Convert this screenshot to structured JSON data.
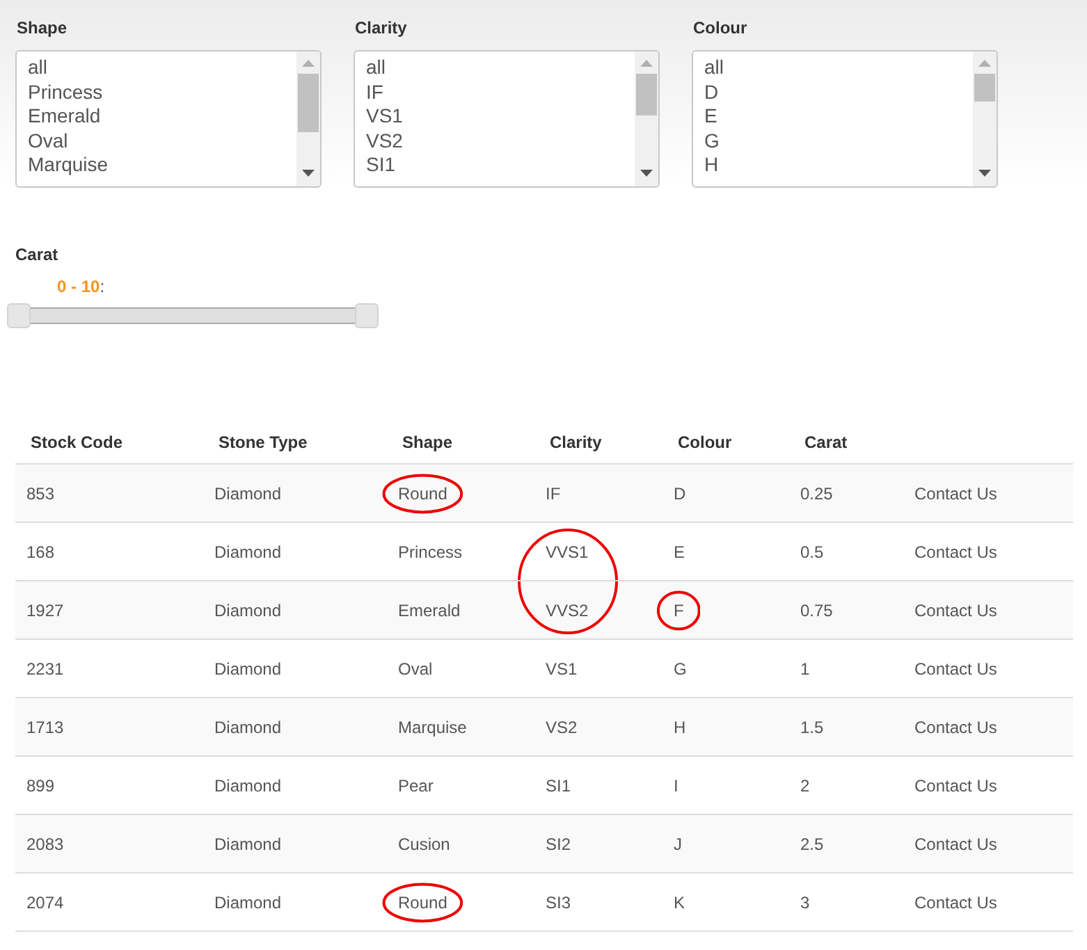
{
  "filters": [
    {
      "label": "Shape",
      "options": [
        "all",
        "Princess",
        "Emerald",
        "Oval",
        "Marquise"
      ]
    },
    {
      "label": "Clarity",
      "options": [
        "all",
        "IF",
        "VS1",
        "VS2",
        "SI1"
      ]
    },
    {
      "label": "Colour",
      "options": [
        "all",
        "D",
        "E",
        "G",
        "H"
      ]
    }
  ],
  "carat": {
    "label": "Carat",
    "value": "0 - 10",
    "suffix": ":",
    "low": {
      "level": 0
    },
    "high": {
      "level": 1
    }
  },
  "table": {
    "columns": [
      "Stock Code",
      "Stone Type",
      "Shape",
      "Clarity",
      "Colour",
      "Carat"
    ],
    "rows": [
      {
        "cells": [
          {
            "text": "853",
            "circled": false
          },
          {
            "text": "Diamond",
            "circled": false
          },
          {
            "text": "Round",
            "circled": true
          },
          {
            "text": "IF",
            "circled": false
          },
          {
            "text": "D",
            "circled": false
          },
          {
            "text": "0.25",
            "circled": false
          },
          {
            "text": "Contact Us",
            "circled": false
          }
        ]
      },
      {
        "cells": [
          {
            "text": "168",
            "circled": false
          },
          {
            "text": "Diamond",
            "circled": false
          },
          {
            "text": "Princess",
            "circled": false
          },
          {
            "text": "VVS1",
            "circled": true
          },
          {
            "text": "E",
            "circled": false
          },
          {
            "text": "0.5",
            "circled": false
          },
          {
            "text": "Contact Us",
            "circled": false
          }
        ]
      },
      {
        "cells": [
          {
            "text": "1927",
            "circled": false
          },
          {
            "text": "Diamond",
            "circled": false
          },
          {
            "text": "Emerald",
            "circled": false
          },
          {
            "text": "VVS2",
            "circled": true
          },
          {
            "text": "F",
            "circled": true
          },
          {
            "text": "0.75",
            "circled": false
          },
          {
            "text": "Contact Us",
            "circled": false
          }
        ]
      },
      {
        "cells": [
          {
            "text": "2231",
            "circled": false
          },
          {
            "text": "Diamond",
            "circled": false
          },
          {
            "text": "Oval",
            "circled": false
          },
          {
            "text": "VS1",
            "circled": false
          },
          {
            "text": "G",
            "circled": false
          },
          {
            "text": "1",
            "circled": false
          },
          {
            "text": "Contact Us",
            "circled": false
          }
        ]
      },
      {
        "cells": [
          {
            "text": "1713",
            "circled": false
          },
          {
            "text": "Diamond",
            "circled": false
          },
          {
            "text": "Marquise",
            "circled": false
          },
          {
            "text": "VS2",
            "circled": false
          },
          {
            "text": "H",
            "circled": false
          },
          {
            "text": "1.5",
            "circled": false
          },
          {
            "text": "Contact Us",
            "circled": false
          }
        ]
      },
      {
        "cells": [
          {
            "text": "899",
            "circled": false
          },
          {
            "text": "Diamond",
            "circled": false
          },
          {
            "text": "Pear",
            "circled": false
          },
          {
            "text": "SI1",
            "circled": false
          },
          {
            "text": "I",
            "circled": false
          },
          {
            "text": "2",
            "circled": false
          },
          {
            "text": "Contact Us",
            "circled": false
          }
        ]
      },
      {
        "cells": [
          {
            "text": "2083",
            "circled": false
          },
          {
            "text": "Diamond",
            "circled": false
          },
          {
            "text": "Cusion",
            "circled": false
          },
          {
            "text": "SI2",
            "circled": false
          },
          {
            "text": "J",
            "circled": false
          },
          {
            "text": "2.5",
            "circled": false
          },
          {
            "text": "Contact Us",
            "circled": false
          }
        ]
      },
      {
        "cells": [
          {
            "text": "2074",
            "circled": false
          },
          {
            "text": "Diamond",
            "circled": false
          },
          {
            "text": "Round",
            "circled": true
          },
          {
            "text": "SI3",
            "circled": false
          },
          {
            "text": "K",
            "circled": false
          },
          {
            "text": "3",
            "circled": false
          },
          {
            "text": "Contact Us",
            "circled": false
          }
        ]
      }
    ]
  }
}
